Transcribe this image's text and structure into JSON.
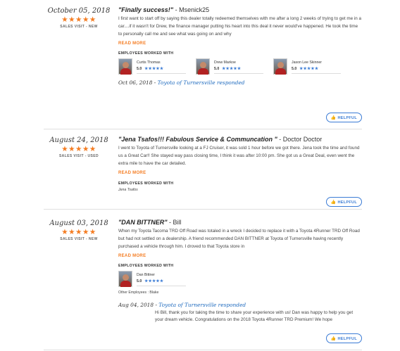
{
  "reviews": [
    {
      "date": "October 05, 2018",
      "stars": "★★★★★",
      "visit": "SALES VISIT - NEW",
      "title": "\"Finally success!\"",
      "author": " - Msenick25",
      "body": "I first want to start off by saying this dealer totally redeemed themselves with me after a long 2 weeks of trying to get me in a car....if it wasn't for Drew, the finance manager putting his heart into this deal it never would've happened. He took the time to personally call me and see what was going on and why",
      "read_more": "READ MORE",
      "employees_heading": "EMPLOYEES WORKED WITH",
      "employees": [
        {
          "name": "Curtis Thomas",
          "score": "5.0",
          "stars": "★★★★★"
        },
        {
          "name": "Drew Markoe",
          "score": "5.0",
          "stars": "★★★★★"
        },
        {
          "name": "Jason Lee Skinner",
          "score": "5.0",
          "stars": "★★★★★"
        }
      ],
      "response_date": "Oct 06, 2018",
      "response_sep": " - ",
      "response_by": "Toyota of Turnersville responded",
      "helpful": "HELPFUL"
    },
    {
      "date": "August 24, 2018",
      "stars": "★★★★★",
      "visit": "SALES VISIT - USED",
      "title": "\"Jena Tsafos!!! Fabulous Service & Communcation \"",
      "author": " - Doctor Doctor",
      "body": "I went to Toyota of Turnersville looking at a FJ Cruiser, it was sold 1 hour before we got there. Jena took the time and found us a Great Car!! She stayed way pass closing time, I think it was after 10:00 pm. She got us a Great Deal, even went the extra mile to have the car detailed.",
      "read_more": "READ MORE",
      "employees_heading": "EMPLOYEES WORKED WITH",
      "employee_text": "Jena Tsafos",
      "helpful": "HELPFUL"
    },
    {
      "date": "August 03, 2018",
      "stars": "★★★★★",
      "visit": "SALES VISIT - NEW",
      "title": "\"DAN BITTNER\"",
      "author": " - Bill",
      "body": "When my Toyota Tacoma TRD Off Road was totaled in a wreck I decided to replace it with a Toyota 4Runner TRD Off Road but had not settled on a dealership. A friend recommended DAN BITTNER at Toyota of Turnersville having recently purchased a vehicle through him. I droved to that Toyota store in",
      "read_more": "READ MORE",
      "employees_heading": "EMPLOYEES WORKED WITH",
      "employees": [
        {
          "name": "Dan Bittner",
          "score": "5.0",
          "stars": "★★★★★"
        }
      ],
      "other_employees": "Other Employees : Blake",
      "response_date": "Aug 04, 2018",
      "response_sep": " - ",
      "response_by": "Toyota of Turnersville responded",
      "response_body": "Hi Bill, thank you for taking the time to share your experience with us! Dan was happy to help you get your dream vehicle. Congratulations on the 2018 Toyota 4Runner TRD Premium! We hope",
      "helpful": "HELPFUL"
    }
  ],
  "colors": {
    "star": "#f47b20",
    "link": "#1f6bbf",
    "helpful": "#3a7bd5"
  },
  "icons": {
    "helpful": "thumbs-up-icon"
  }
}
